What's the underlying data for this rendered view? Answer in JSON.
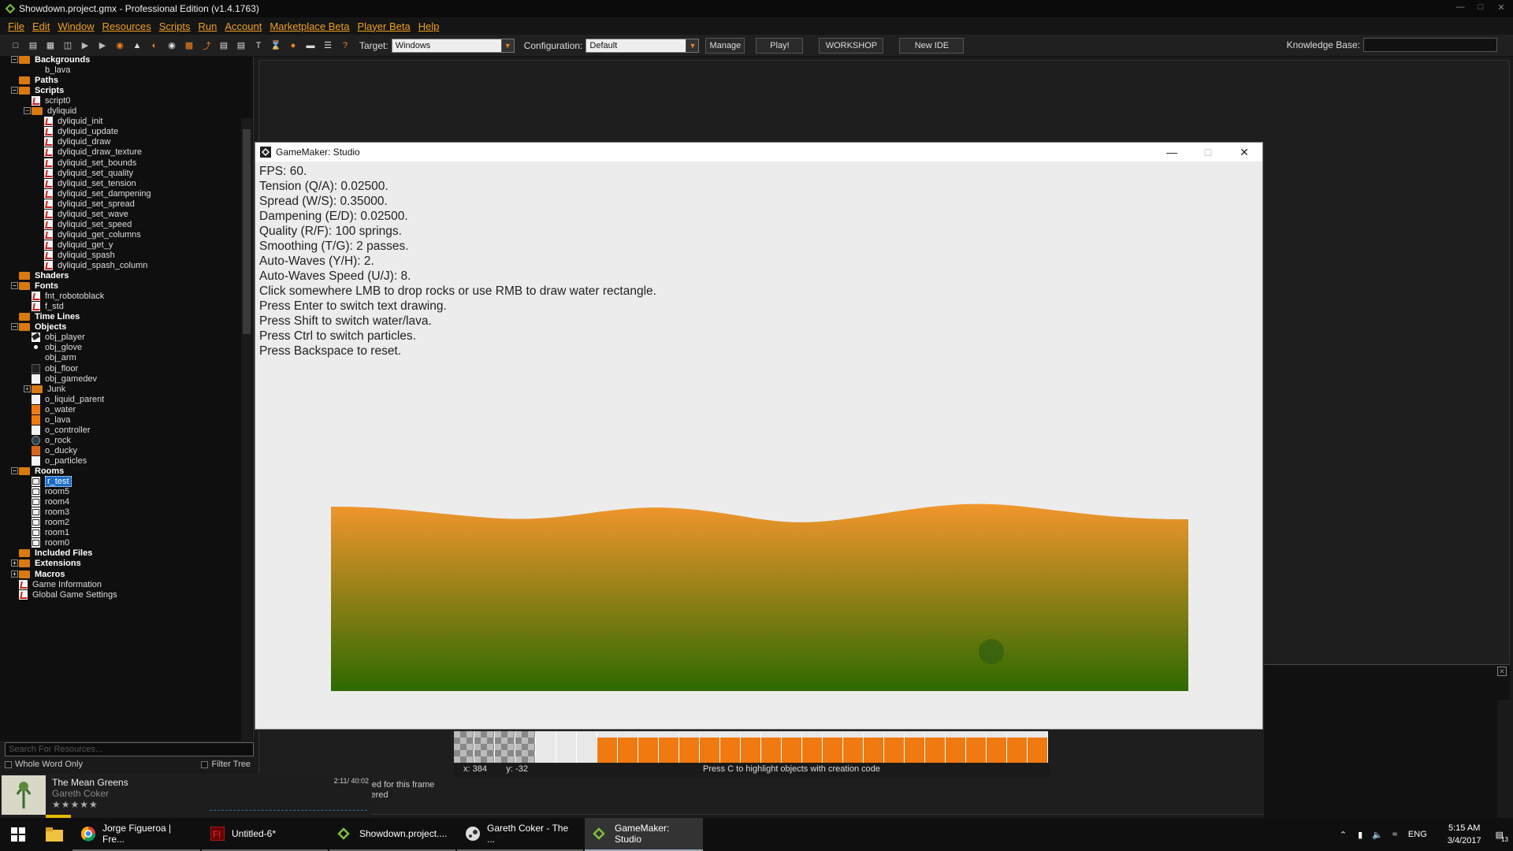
{
  "window": {
    "title": "Showdown.project.gmx  -  Professional Edition (v1.4.1763)"
  },
  "menu": [
    "File",
    "Edit",
    "Window",
    "Resources",
    "Scripts",
    "Run",
    "Account",
    "Marketplace Beta",
    "Player Beta",
    "Help"
  ],
  "toolbar": {
    "target_label": "Target:",
    "target_value": "Windows",
    "config_label": "Configuration:",
    "config_value": "Default",
    "manage": "Manage",
    "play": "Play!",
    "workshop": "WORKSHOP",
    "new_ide": "New IDE",
    "kb_label": "Knowledge Base:"
  },
  "tree": [
    {
      "level": 0,
      "label": "Backgrounds",
      "type": "folder",
      "exp": "-"
    },
    {
      "level": 1,
      "label": "b_lava",
      "type": "none"
    },
    {
      "level": 0,
      "label": "Paths",
      "type": "folder"
    },
    {
      "level": 0,
      "label": "Scripts",
      "type": "folder",
      "exp": "-"
    },
    {
      "level": 1,
      "label": "script0",
      "type": "script"
    },
    {
      "level": 1,
      "label": "dyliquid",
      "type": "subfolder",
      "exp": "-"
    },
    {
      "level": 2,
      "label": "dyliquid_init",
      "type": "script"
    },
    {
      "level": 2,
      "label": "dyliquid_update",
      "type": "script"
    },
    {
      "level": 2,
      "label": "dyliquid_draw",
      "type": "script"
    },
    {
      "level": 2,
      "label": "dyliquid_draw_texture",
      "type": "script"
    },
    {
      "level": 2,
      "label": "dyliquid_set_bounds",
      "type": "script"
    },
    {
      "level": 2,
      "label": "dyliquid_set_quality",
      "type": "script"
    },
    {
      "level": 2,
      "label": "dyliquid_set_tension",
      "type": "script"
    },
    {
      "level": 2,
      "label": "dyliquid_set_dampening",
      "type": "script"
    },
    {
      "level": 2,
      "label": "dyliquid_set_spread",
      "type": "script"
    },
    {
      "level": 2,
      "label": "dyliquid_set_wave",
      "type": "script"
    },
    {
      "level": 2,
      "label": "dyliquid_set_speed",
      "type": "script"
    },
    {
      "level": 2,
      "label": "dyliquid_get_columns",
      "type": "script"
    },
    {
      "level": 2,
      "label": "dyliquid_get_y",
      "type": "script"
    },
    {
      "level": 2,
      "label": "dyliquid_spash",
      "type": "script"
    },
    {
      "level": 2,
      "label": "dyliquid_spash_column",
      "type": "script"
    },
    {
      "level": 0,
      "label": "Shaders",
      "type": "folder"
    },
    {
      "level": 0,
      "label": "Fonts",
      "type": "folder",
      "exp": "-"
    },
    {
      "level": 1,
      "label": "fnt_robotoblack",
      "type": "script"
    },
    {
      "level": 1,
      "label": "f_std",
      "type": "script"
    },
    {
      "level": 0,
      "label": "Time Lines",
      "type": "folder"
    },
    {
      "level": 0,
      "label": "Objects",
      "type": "folder",
      "exp": "-"
    },
    {
      "level": 1,
      "label": "obj_player",
      "type": "glove"
    },
    {
      "level": 1,
      "label": "obj_glove",
      "type": "dot"
    },
    {
      "level": 1,
      "label": "obj_arm",
      "type": "none"
    },
    {
      "level": 1,
      "label": "obj_floor",
      "type": "dark"
    },
    {
      "level": 1,
      "label": "obj_gamedev",
      "type": "plain"
    },
    {
      "level": 1,
      "label": "Junk",
      "type": "subfolder",
      "exp": "+"
    },
    {
      "level": 1,
      "label": "o_liquid_parent",
      "type": "plain"
    },
    {
      "level": 1,
      "label": "o_water",
      "type": "orange"
    },
    {
      "level": 1,
      "label": "o_lava",
      "type": "orange"
    },
    {
      "level": 1,
      "label": "o_controller",
      "type": "plain"
    },
    {
      "level": 1,
      "label": "o_rock",
      "type": "circle"
    },
    {
      "level": 1,
      "label": "o_ducky",
      "type": "orange2"
    },
    {
      "level": 1,
      "label": "o_particles",
      "type": "plain"
    },
    {
      "level": 0,
      "label": "Rooms",
      "type": "folder",
      "exp": "-"
    },
    {
      "level": 1,
      "label": "r_test",
      "type": "room",
      "selected": true
    },
    {
      "level": 1,
      "label": "room5",
      "type": "room"
    },
    {
      "level": 1,
      "label": "room4",
      "type": "room"
    },
    {
      "level": 1,
      "label": "room3",
      "type": "room"
    },
    {
      "level": 1,
      "label": "room2",
      "type": "room"
    },
    {
      "level": 1,
      "label": "room1",
      "type": "room"
    },
    {
      "level": 1,
      "label": "room0",
      "type": "room"
    },
    {
      "level": 0,
      "label": "Included Files",
      "type": "folder"
    },
    {
      "level": 0,
      "label": "Extensions",
      "type": "folder",
      "exp": "+"
    },
    {
      "level": 0,
      "label": "Macros",
      "type": "folder",
      "exp": "+"
    },
    {
      "level": 0,
      "label": "Game Information",
      "type": "info",
      "plain": true
    },
    {
      "level": 0,
      "label": "Global Game Settings",
      "type": "settings",
      "plain": true
    }
  ],
  "search": {
    "placeholder": "Search For Resources...",
    "whole_word": "Whole Word Only",
    "filter": "Filter Tree"
  },
  "game_window": {
    "title": "GameMaker: Studio",
    "lines": [
      "FPS: 60.",
      "Tension (Q/A): 0.02500.",
      "Spread (W/S): 0.35000.",
      "Dampening (E/D): 0.02500.",
      "Quality (R/F): 100 springs.",
      "Smoothing (T/G): 2 passes.",
      "Auto-Waves (Y/H): 2.",
      "Auto-Waves Speed (U/J): 8.",
      "Click somewhere LMB to drop rocks or use RMB to draw water rectangle.",
      "Press Enter to switch text drawing.",
      "Press Shift to switch water/lava.",
      "Press Ctrl to switch particles.",
      "Press Backspace to reset."
    ],
    "lava_top": "#f2962c",
    "lava_bottom": "#2d6a00"
  },
  "room_editor": {
    "x": "x: 384",
    "y": "y: -32",
    "msg": "Press C to highlight objects with creation code"
  },
  "output": [
    "ered for this frame",
    "stered"
  ],
  "player": {
    "title": "The Mean Greens",
    "artist": "Gareth Coker",
    "time": "2:11/ 40:02",
    "stars": "★★★★★"
  },
  "taskbar": {
    "items": [
      {
        "label": "Jorge Figueroa | Fre...",
        "icon": "chrome"
      },
      {
        "label": "Untitled-6*",
        "icon": "flash"
      },
      {
        "label": "Showdown.project....",
        "icon": "gm"
      },
      {
        "label": "Gareth Coker - The ...",
        "icon": "steam"
      },
      {
        "label": "GameMaker: Studio",
        "icon": "gm",
        "active": true
      }
    ],
    "lang": "ENG",
    "time": "5:15 AM",
    "date": "3/4/2017",
    "notif": "13"
  }
}
